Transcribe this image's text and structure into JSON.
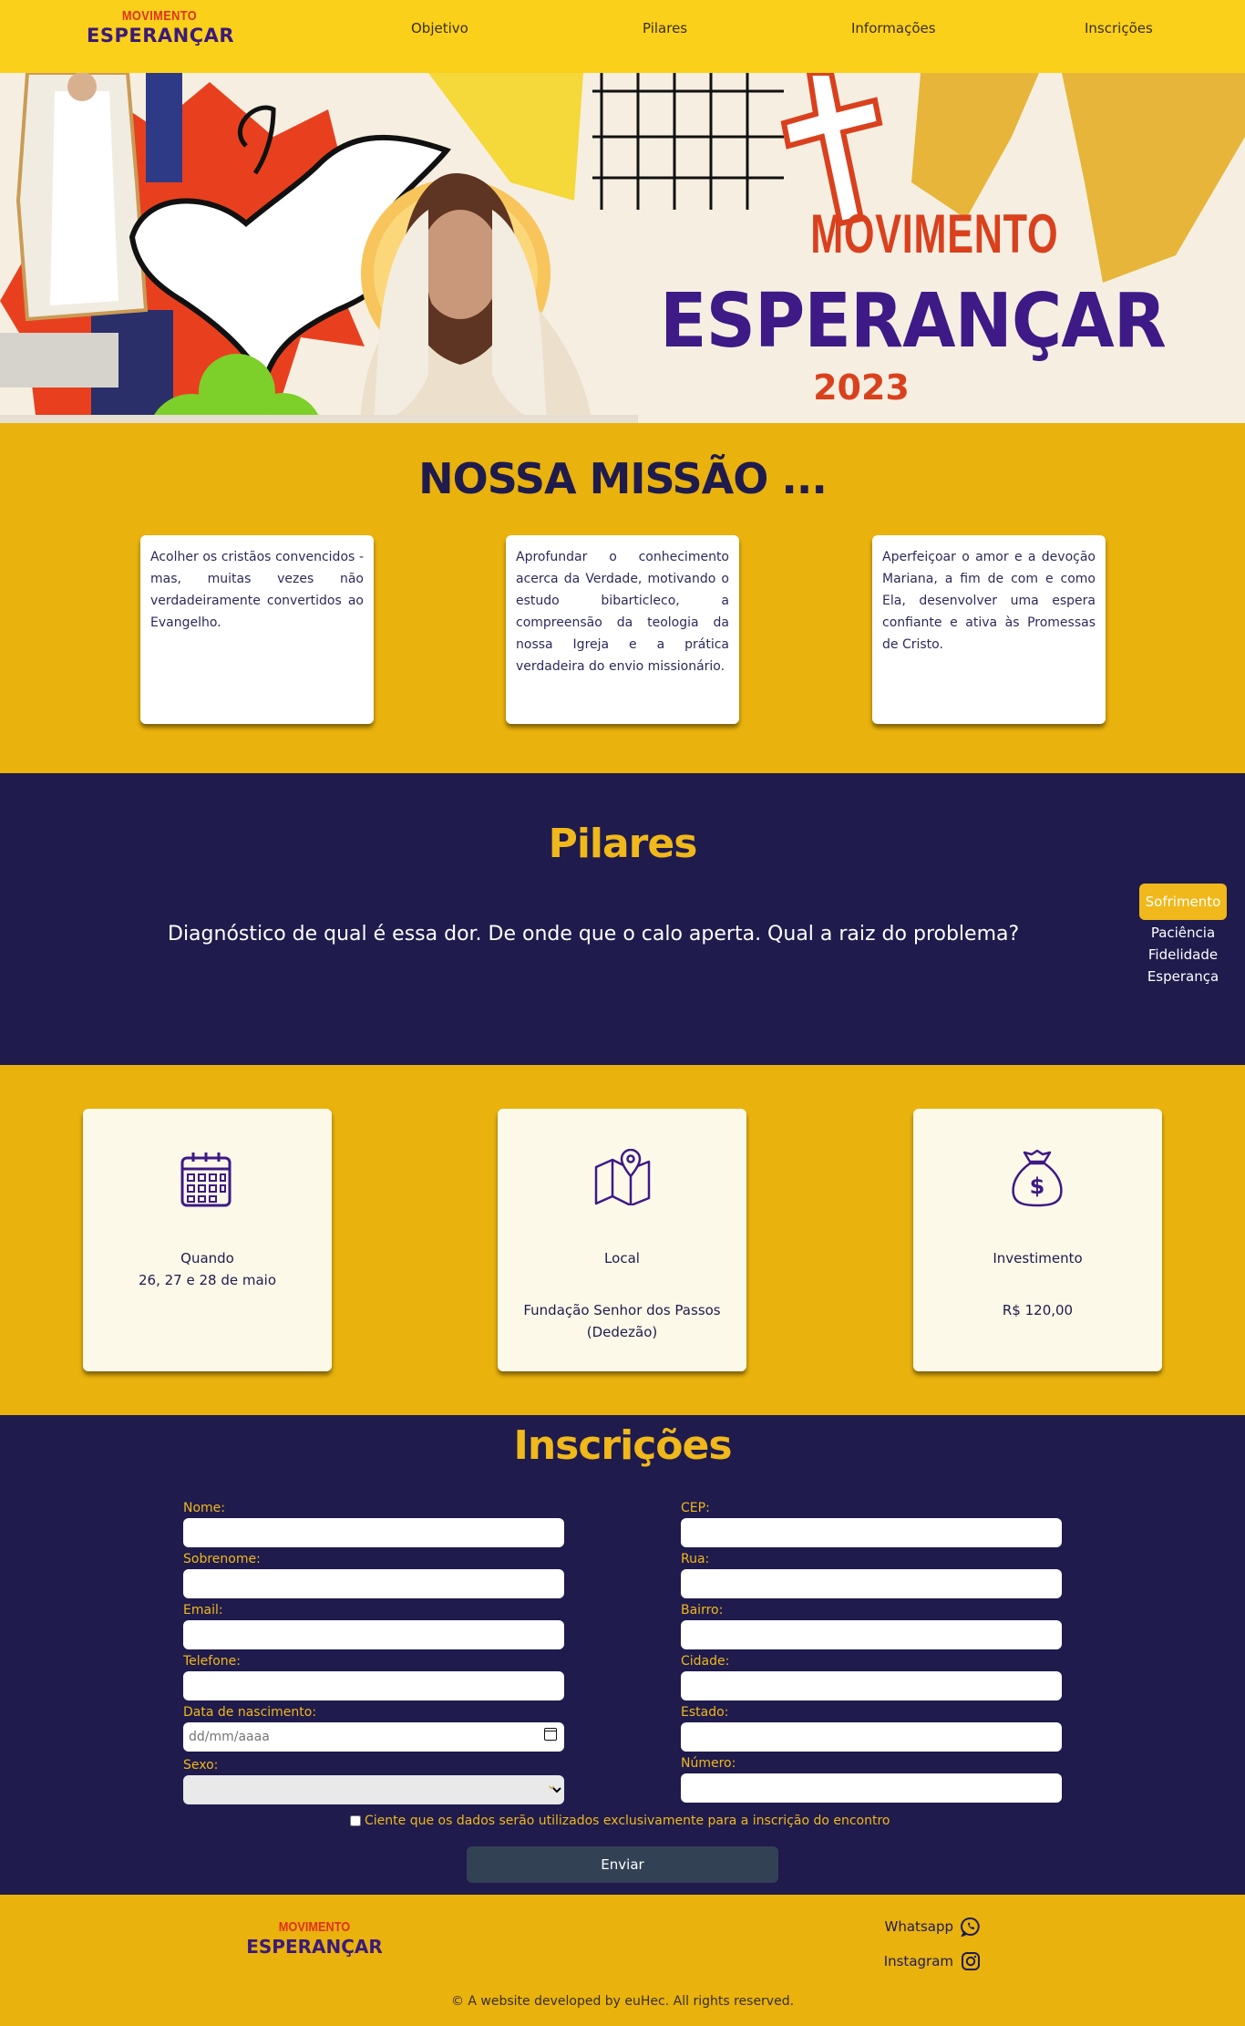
{
  "nav": {
    "logo_top": "MOVIMENTO",
    "logo_bottom": "ESPERANÇAR",
    "links": [
      "Objetivo",
      "Pilares",
      "Informações",
      "Inscrições"
    ]
  },
  "hero": {
    "title_top": "MOVIMENTO",
    "title_main": "ESPERANÇAR",
    "year": "2023"
  },
  "mission": {
    "title": "NOSSA MISSÃO ...",
    "cards": [
      "Acolher os cristãos convencidos - mas, muitas vezes não verdadeiramente convertidos ao Evangelho.",
      "Aprofundar o conhecimento acerca da Verdade, motivando o estudo bibarticleco, a compreensão da teologia da nossa Igreja e a prática verdadeira do envio missionário.",
      "Aperfeiçoar o amor e a devoção Mariana, a fim de com e como Ela, desenvolver uma espera confiante e ativa às Promessas de Cristo."
    ]
  },
  "pilares": {
    "title": "Pilares",
    "text": "Diagnóstico de qual é essa dor. De onde que o calo aperta. Qual a raiz do problema?",
    "tabs": [
      "Sofrimento",
      "Paciência",
      "Fidelidade",
      "Esperança"
    ],
    "active_tab": "Sofrimento"
  },
  "info": {
    "when_label": "Quando",
    "when_value": "26, 27 e 28 de maio",
    "where_label": "Local",
    "where_value": "Fundação Senhor dos Passos (Dedezão)",
    "cost_label": "Investimento",
    "cost_value": "R$ 120,00"
  },
  "form": {
    "title": "Inscrições",
    "left_fields": [
      "Nome:",
      "Sobrenome:",
      "Email:",
      "Telefone:",
      "Data de nascimento:",
      "Sexo:"
    ],
    "right_fields": [
      "CEP:",
      "Rua:",
      "Bairro:",
      "Cidade:",
      "Estado:",
      "Número:"
    ],
    "date_placeholder": "dd/mm/aaaa",
    "consent": "Ciente que os dados serão utilizados exclusivamente para a inscrição do encontro",
    "submit": "Enviar"
  },
  "footer": {
    "logo_top": "MOVIMENTO",
    "logo_bottom": "ESPERANÇAR",
    "whatsapp": "Whatsapp",
    "instagram": "Instagram",
    "copyright": "© A website developed by euHec. All rights reserved."
  },
  "colors": {
    "yellow": "#fbd01b",
    "mustard": "#e9b20d",
    "navy": "#1f1b4d",
    "purple": "#3d1a86",
    "red": "#d9411e",
    "button": "#334155"
  }
}
